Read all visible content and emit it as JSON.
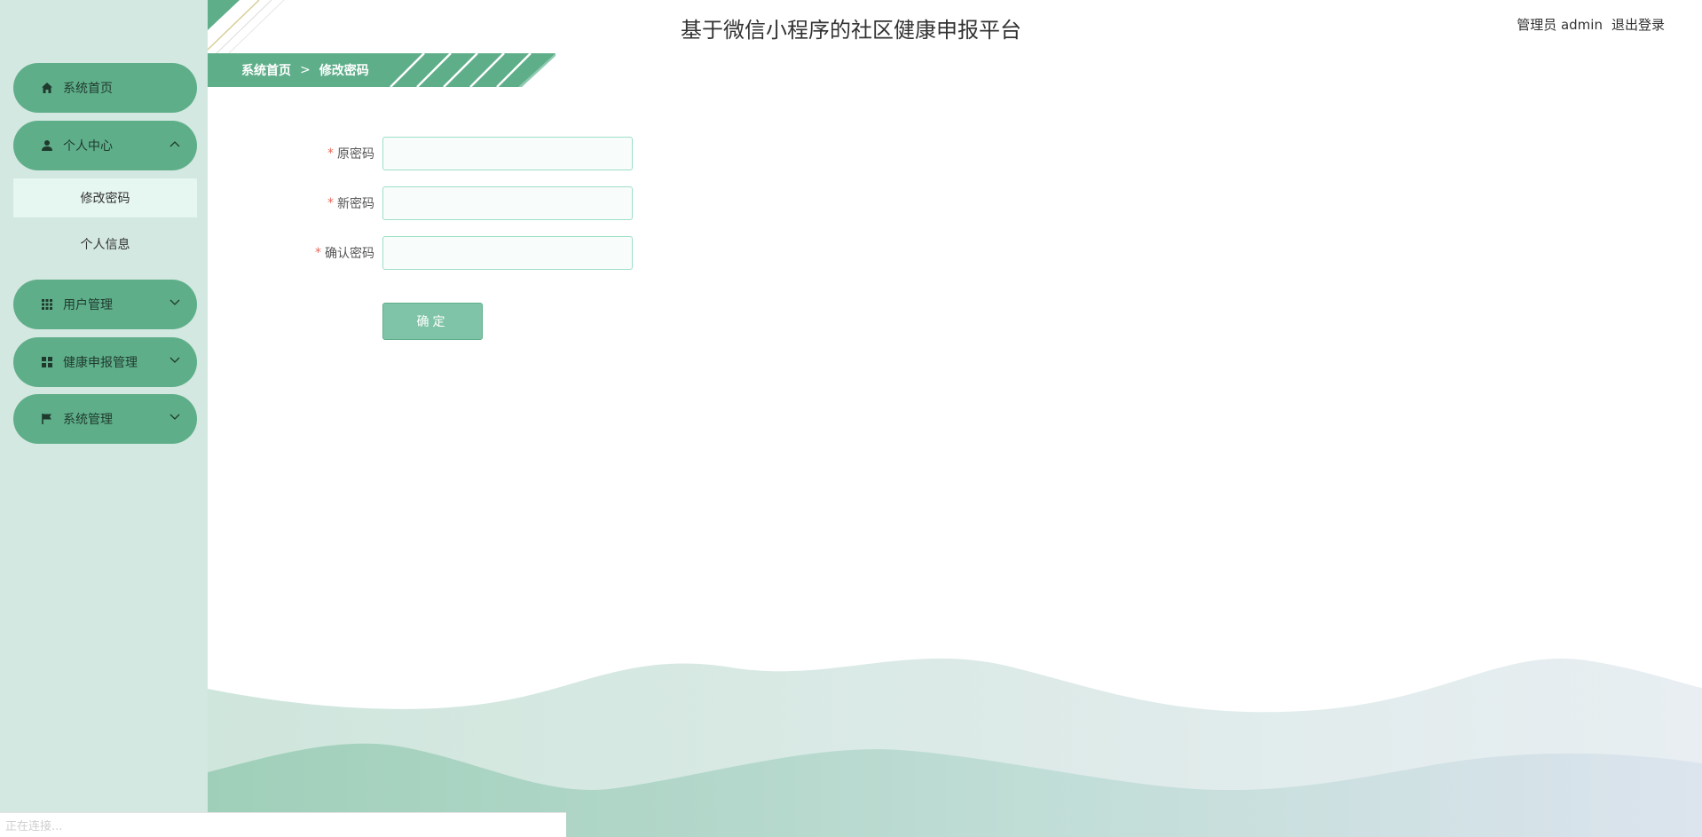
{
  "app": {
    "title": "基于微信小程序的社区健康申报平台"
  },
  "header": {
    "user_text": "管理员 admin",
    "logout_label": "退出登录"
  },
  "breadcrumb": {
    "home": "系统首页",
    "separator": ">",
    "current": "修改密码"
  },
  "sidebar": {
    "items": [
      {
        "label": "系统首页",
        "icon": "home-icon"
      },
      {
        "label": "个人中心",
        "icon": "user-icon",
        "expanded": true
      },
      {
        "label": "用户管理",
        "icon": "grid-icon"
      },
      {
        "label": "健康申报管理",
        "icon": "dashboard-icon"
      },
      {
        "label": "系统管理",
        "icon": "flag-icon"
      }
    ],
    "submenu": [
      {
        "label": "修改密码",
        "active": true
      },
      {
        "label": "个人信息",
        "active": false
      }
    ]
  },
  "form": {
    "required_mark": "*",
    "fields": [
      {
        "label": "原密码",
        "value": ""
      },
      {
        "label": "新密码",
        "value": ""
      },
      {
        "label": "确认密码",
        "value": ""
      }
    ],
    "submit_label": "确定"
  },
  "status": {
    "text": "正在连接..."
  },
  "colors": {
    "accent": "#5fae8a",
    "sidebar_bg": "#d3e8e0",
    "active_sub_bg": "#e6f6f1",
    "required": "#e66b5b"
  }
}
